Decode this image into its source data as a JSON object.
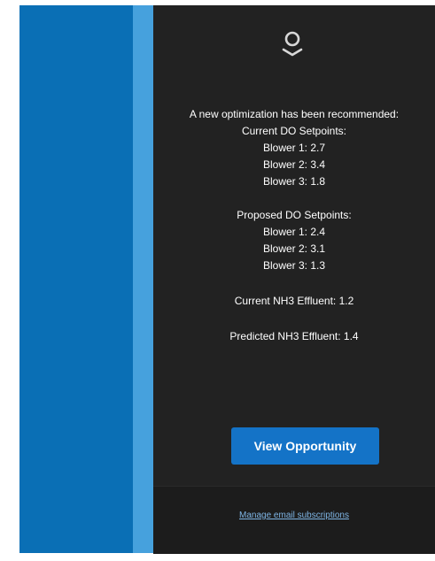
{
  "colors": {
    "left_stripe": "#0a6fb5",
    "accent_stripe": "#46a1dd",
    "panel_bg": "#222222",
    "button_bg": "#1473c7",
    "link": "#7fb6e6"
  },
  "header": {
    "logo_icon": "location-pin-ring-icon"
  },
  "email": {
    "intro": "A new optimization has been recommended:",
    "current_heading": "Current DO Setpoints:",
    "current_setpoints": [
      "Blower 1: 2.7",
      "Blower 2: 3.4",
      "Blower 3: 1.8"
    ],
    "proposed_heading": "Proposed DO Setpoints:",
    "proposed_setpoints": [
      "Blower 1: 2.4",
      "Blower 2: 3.1",
      "Blower 3: 1.3"
    ],
    "current_effluent": "Current NH3 Effluent: 1.2",
    "predicted_effluent": "Predicted NH3 Effluent: 1.4"
  },
  "actions": {
    "view_label": "View Opportunity"
  },
  "footer": {
    "manage_label": "Manage email subscriptions"
  }
}
